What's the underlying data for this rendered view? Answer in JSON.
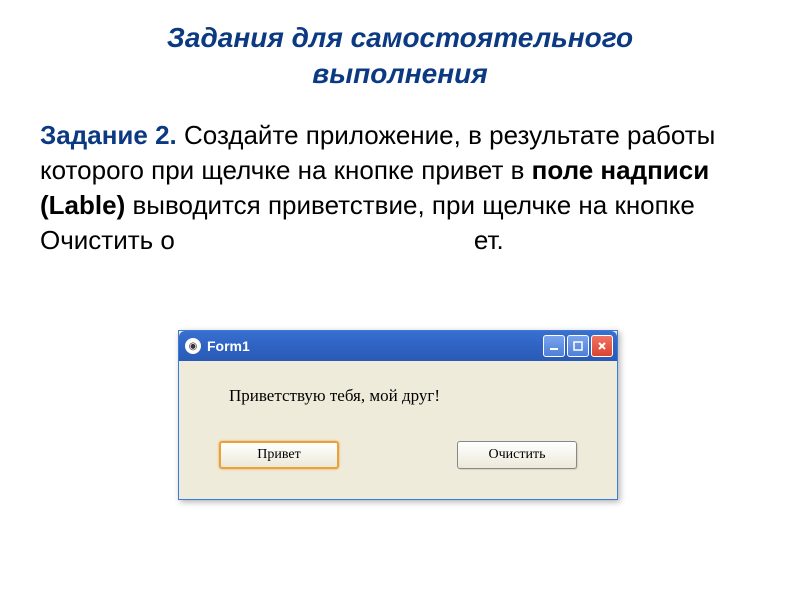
{
  "slide": {
    "title": "Задания для самостоятельного выполнения",
    "task_label": "Задание 2.",
    "task_text_1": " Создайте приложение, в результате работы которого при щелчке на кнопке привет в ",
    "task_bold_1": "поле надписи (Lable)",
    "task_text_2": " выводится приветствие, при щелчке на кнопке Очистить о",
    "task_text_3": "ет."
  },
  "window": {
    "title": "Form1",
    "greeting": "Приветствую тебя, мой друг!",
    "buttons": {
      "hello": "Привет",
      "clear": "Очистить"
    }
  }
}
